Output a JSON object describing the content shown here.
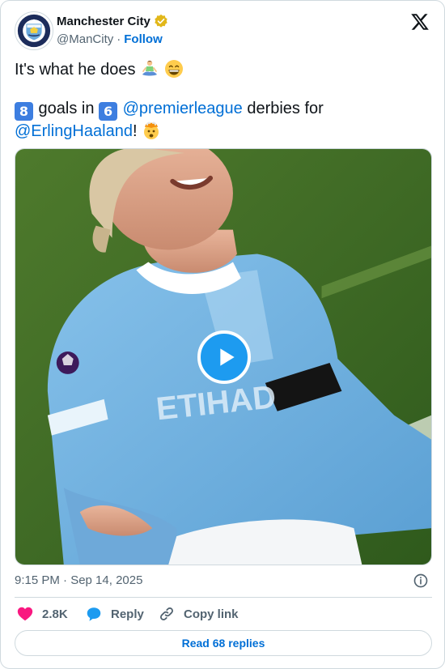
{
  "author": {
    "display_name": "Manchester City",
    "handle": "@ManCity",
    "separator": "·",
    "follow_label": "Follow",
    "avatar_icon": "man-city-crest",
    "verified_icon": "gold-verified-badge"
  },
  "tweet": {
    "line1_text": "It's what he does",
    "line1_emojis": [
      "person-in-lotus-position",
      "grinning-face-with-smiling-eyes"
    ],
    "line2_keycap1": "8",
    "line2_text1": " goals in ",
    "line2_keycap2": "6",
    "line2_mention1": "@premierleague",
    "line2_text2": " derbies for",
    "line3_mention": "@ErlingHaaland",
    "line3_text": "!",
    "line3_emoji": "exploding-head"
  },
  "media": {
    "type": "video",
    "play_icon": "play-icon",
    "jersey_text": "ETIHAD"
  },
  "meta": {
    "timestamp": "9:15 PM · Sep 14, 2025",
    "info_icon": "info-icon"
  },
  "actions": {
    "like_count": "2.8K",
    "reply_label": "Reply",
    "copy_link_label": "Copy link"
  },
  "footer": {
    "read_replies_label": "Read 68 replies"
  },
  "colors": {
    "link": "#006fd6",
    "accent": "#1d9bf0",
    "like": "#f91880",
    "muted": "#536471",
    "border": "#cfd9de"
  }
}
